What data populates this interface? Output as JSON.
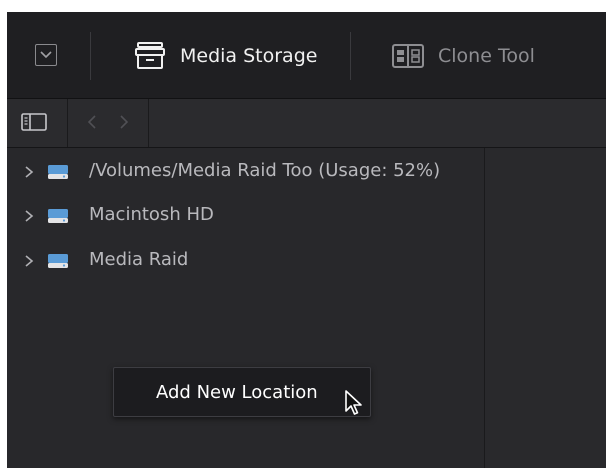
{
  "tabs": [
    {
      "label": "Media Storage",
      "icon": "archive-icon",
      "active": true
    },
    {
      "label": "Clone Tool",
      "icon": "clone-tool-icon",
      "active": false
    }
  ],
  "tree": {
    "items": [
      {
        "label": "/Volumes/Media Raid Too (Usage: 52%)",
        "icon": "drive-icon"
      },
      {
        "label": "Macintosh HD",
        "icon": "drive-icon"
      },
      {
        "label": "Media Raid",
        "icon": "drive-icon"
      }
    ]
  },
  "context_menu": {
    "items": [
      {
        "label": "Add New Location"
      }
    ]
  },
  "colors": {
    "background": "#28282b",
    "topbar": "#1f1f22",
    "drive_accent": "#5a9bd6",
    "text_active": "#f1f1f1",
    "text_inactive": "#8e8e92"
  }
}
